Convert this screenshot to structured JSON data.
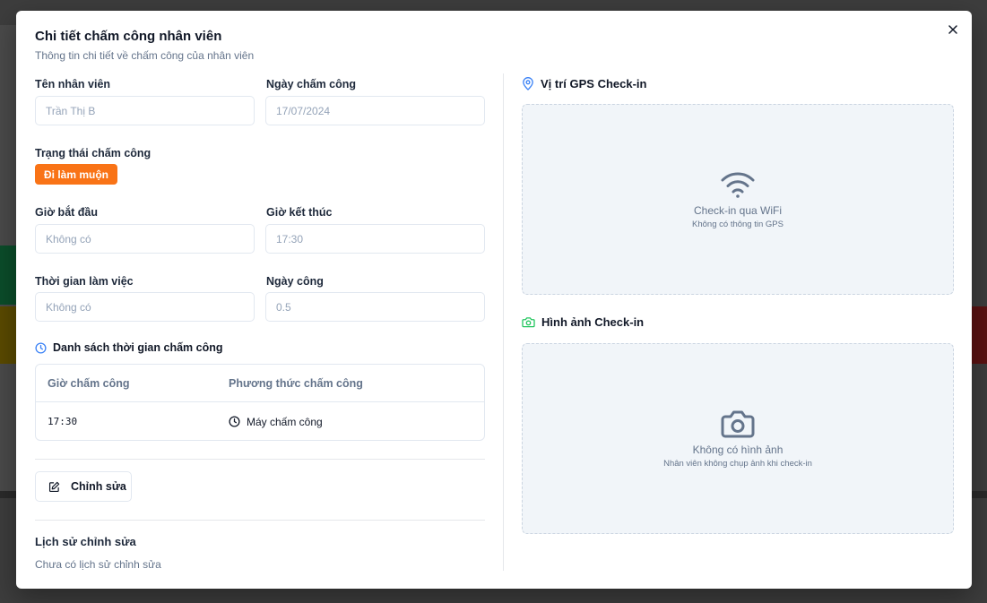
{
  "modal": {
    "title": "Chi tiết chấm công nhân viên",
    "subtitle": "Thông tin chi tiết về chấm công của nhân viên"
  },
  "fields": {
    "employee_name": {
      "label": "Tên nhân viên",
      "value": "Trần Thị B"
    },
    "work_date": {
      "label": "Ngày chấm công",
      "value": "17/07/2024"
    },
    "status": {
      "label": "Trạng thái chấm công",
      "badge": "Đi làm muộn",
      "badge_color": "#f97316"
    },
    "start_time": {
      "label": "Giờ bắt đầu",
      "value": "Không có"
    },
    "end_time": {
      "label": "Giờ kết thúc",
      "value": "17:30"
    },
    "work_duration": {
      "label": "Thời gian làm việc",
      "value": "Không có"
    },
    "work_days": {
      "label": "Ngày công",
      "value": "0.5"
    }
  },
  "timekeeping_list": {
    "title": "Danh sách thời gian chấm công",
    "icon": "clock-icon",
    "columns": [
      "Giờ chấm công",
      "Phương thức chấm công"
    ],
    "rows": [
      {
        "time": "17:30",
        "method": "Máy chấm công",
        "method_icon": "clock-icon"
      }
    ]
  },
  "edit_button": {
    "label": "Chỉnh sửa",
    "icon": "edit-icon"
  },
  "edit_history": {
    "title": "Lịch sử chỉnh sửa",
    "empty": "Chưa có lịch sử chỉnh sửa"
  },
  "gps": {
    "title": "Vị trí GPS Check-in",
    "icon": "map-pin-icon",
    "icon_color": "#3b82f6",
    "placeholder_icon": "wifi-icon",
    "main": "Check-in qua WiFi",
    "sub": "Không có thông tin GPS"
  },
  "photo": {
    "title": "Hình ảnh Check-in",
    "icon": "camera-icon",
    "icon_color": "#22c55e",
    "placeholder_icon": "camera-icon",
    "main": "Không có hình ảnh",
    "sub": "Nhân viên không chụp ảnh khi check-in"
  }
}
